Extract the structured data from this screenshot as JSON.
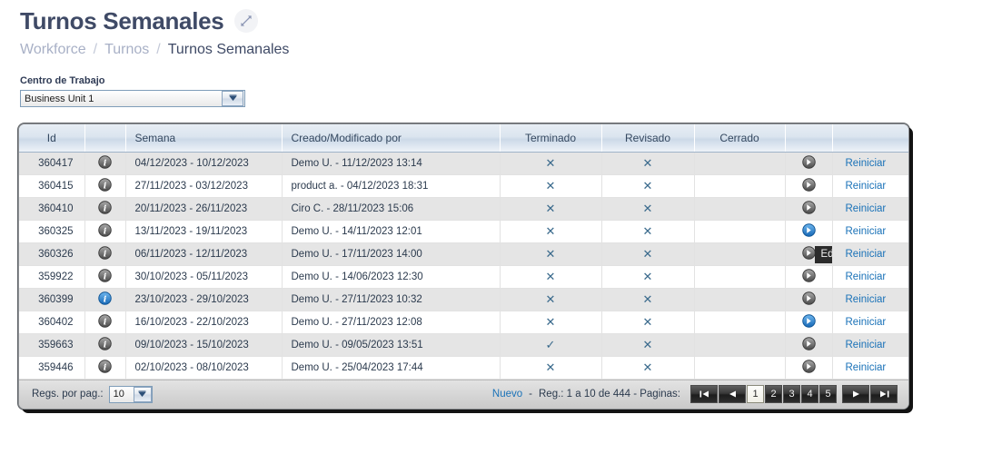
{
  "header": {
    "title": "Turnos Semanales",
    "expand_icon": "expand-arrows-icon"
  },
  "breadcrumb": {
    "items": [
      "Workforce",
      "Turnos",
      "Turnos Semanales"
    ],
    "separator": "/"
  },
  "filter": {
    "label": "Centro de Trabajo",
    "value": "Business Unit 1",
    "arrow_icon": "chevron-down-icon"
  },
  "grid": {
    "columns": [
      "Id",
      "",
      "Semana",
      "Creado/Modificado por",
      "Terminado",
      "Revisado",
      "Cerrado",
      "",
      ""
    ],
    "action_link_label": "Reiniciar",
    "info_icon": "info-circle-icon",
    "edit_icon": "arrow-right-circle-icon",
    "mark_false": "✕",
    "mark_true": "✓",
    "tooltip": "Editar",
    "rows": [
      {
        "id": "360417",
        "info_state": "gray",
        "semana": "04/12/2023 - 10/12/2023",
        "creado": "Demo U. - 11/12/2023 13:14",
        "terminado": false,
        "revisado": false,
        "cerrado": "",
        "action_state": "gray",
        "link": "Reiniciar"
      },
      {
        "id": "360415",
        "info_state": "gray",
        "semana": "27/11/2023 - 03/12/2023",
        "creado": "product a. - 04/12/2023 18:31",
        "terminado": false,
        "revisado": false,
        "cerrado": "",
        "action_state": "gray",
        "link": "Reiniciar"
      },
      {
        "id": "360410",
        "info_state": "gray",
        "semana": "20/11/2023 - 26/11/2023",
        "creado": "Ciro C. - 28/11/2023 15:06",
        "terminado": false,
        "revisado": false,
        "cerrado": "",
        "action_state": "gray",
        "link": "Reiniciar"
      },
      {
        "id": "360325",
        "info_state": "gray",
        "semana": "13/11/2023 - 19/11/2023",
        "creado": "Demo U. - 14/11/2023 12:01",
        "terminado": false,
        "revisado": false,
        "cerrado": "",
        "action_state": "blue",
        "link": "Reiniciar"
      },
      {
        "id": "360326",
        "info_state": "gray",
        "semana": "06/11/2023 - 12/11/2023",
        "creado": "Demo U. - 17/11/2023 14:00",
        "terminado": false,
        "revisado": false,
        "cerrado": "",
        "action_state": "gray",
        "link": "Reiniciar",
        "tooltip_visible": true
      },
      {
        "id": "359922",
        "info_state": "gray",
        "semana": "30/10/2023 - 05/11/2023",
        "creado": "Demo U. - 14/06/2023 12:30",
        "terminado": false,
        "revisado": false,
        "cerrado": "",
        "action_state": "gray",
        "link": "Reiniciar"
      },
      {
        "id": "360399",
        "info_state": "blue",
        "semana": "23/10/2023 - 29/10/2023",
        "creado": "Demo U. - 27/11/2023 10:32",
        "terminado": false,
        "revisado": false,
        "cerrado": "",
        "action_state": "gray",
        "link": "Reiniciar"
      },
      {
        "id": "360402",
        "info_state": "gray",
        "semana": "16/10/2023 - 22/10/2023",
        "creado": "Demo U. - 27/11/2023 12:08",
        "terminado": false,
        "revisado": false,
        "cerrado": "",
        "action_state": "blue",
        "link": "Reiniciar"
      },
      {
        "id": "359663",
        "info_state": "gray",
        "semana": "09/10/2023 - 15/10/2023",
        "creado": "Demo U. - 09/05/2023 13:51",
        "terminado": true,
        "revisado": false,
        "cerrado": "",
        "action_state": "gray",
        "link": "Reiniciar"
      },
      {
        "id": "359446",
        "info_state": "gray",
        "semana": "02/10/2023 - 08/10/2023",
        "creado": "Demo U. - 25/04/2023 17:44",
        "terminado": false,
        "revisado": false,
        "cerrado": "",
        "action_state": "gray",
        "link": "Reiniciar"
      }
    ]
  },
  "footer": {
    "rows_per_page_label": "Regs. por pag.:",
    "rows_per_page_value": "10",
    "new_label": "Nuevo",
    "dash": "-",
    "range_text": "Reg.: 1 a 10 de 444 - Paginas:",
    "pages": [
      "1",
      "2",
      "3",
      "4",
      "5"
    ],
    "active_page": "1",
    "nav": {
      "first": "first-page-icon",
      "prev": "prev-page-icon",
      "next": "next-page-icon",
      "last": "last-page-icon"
    }
  },
  "colors": {
    "title": "#3f4a66",
    "breadcrumb_muted": "#9aa3bb",
    "link": "#1a72b8",
    "mark": "#3a6a8c",
    "icon_blue": "#1e7fd4",
    "icon_gray": "#6d6d6d"
  }
}
